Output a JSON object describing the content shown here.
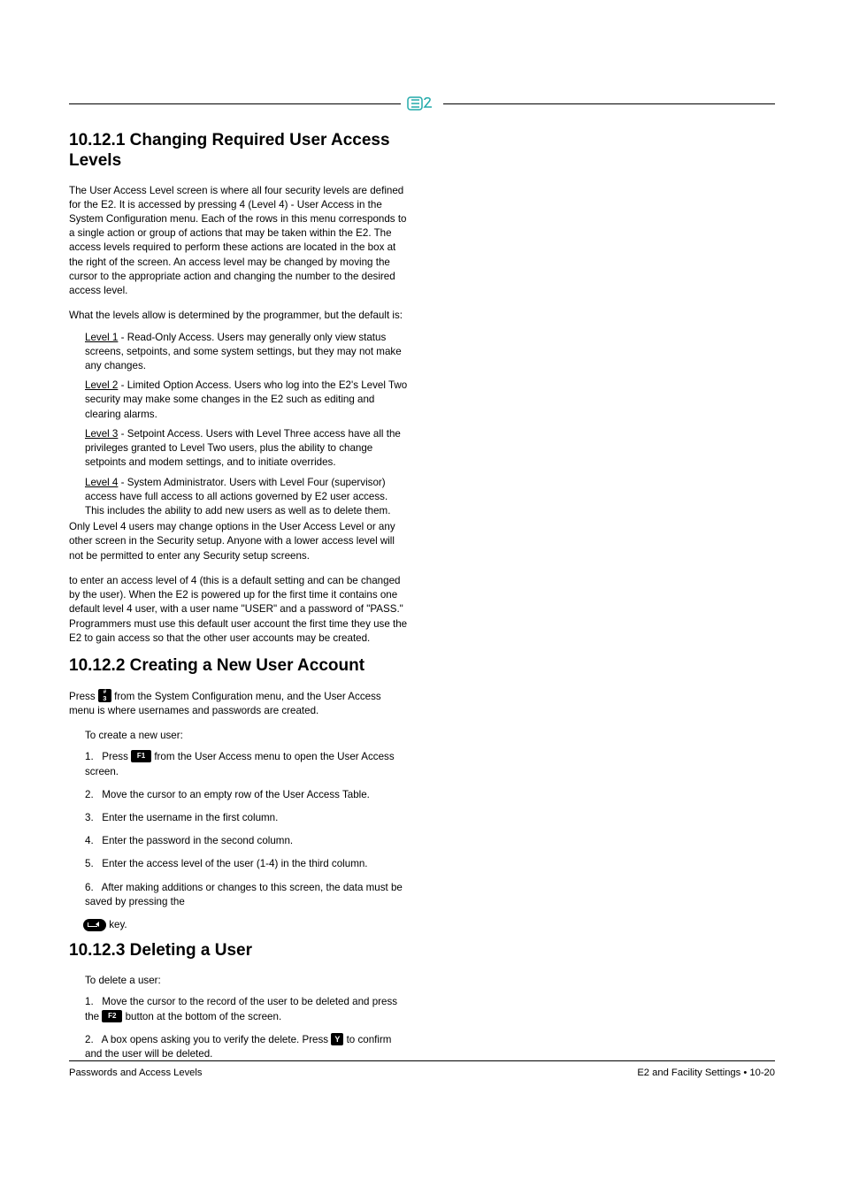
{
  "headings": {
    "s1": "10.12.1  Changing Required User Access Levels",
    "s2": "10.12.2  Creating a New User Account",
    "s3": "10.12.3  Deleting a User"
  },
  "col1": {
    "intro": "The User Access Level screen is where all four security levels are defined for the E2. It is accessed by pressing 4 (Level 4) - User Access in the System Configuration menu. Each of the rows in this menu corresponds to a single action or group of actions that may be taken within the E2. The access levels required to perform these actions are located in the box at the right of the screen. An access level may be changed by moving the cursor to the appropriate action and changing the number to the desired access level.",
    "intro2": "What the levels allow is determined by the programmer, but the default is:",
    "levels": [
      {
        "name": "Level 1",
        "title": "Read-Only Access.",
        "body": " Users may generally only view status screens, setpoints, and some system settings, but they may not make any changes."
      },
      {
        "name": "Level 2",
        "title": "Limited Option Access.",
        "body": " Users who log into the E2's Level Two security may make some changes in the E2 such as editing and clearing alarms."
      },
      {
        "name": "Level 3",
        "title": "Setpoint Access.",
        "body": " Users with Level Three access have all the privileges granted to Level Two users, plus the ability to change setpoints and modem settings, and to initiate overrides."
      },
      {
        "name": "Level 4",
        "title": "System Administrator.",
        "body": " Users with Level Four (supervisor) access have full access to all actions governed by E2 user access. This includes the ability to add new users as well as to delete them."
      }
    ]
  },
  "col2": {
    "p1a": "Only Level 4 users may change options in the User Access Level or any other screen in the Security setup. Anyone with a lower access level will not be permitted to enter any Security setup screens.",
    "p1b": "to enter an access level of 4 (this is a default setting and can be changed by the user). When the E2 is powered up for the first time it contains one default level 4 user, with a user name \"USER\" and a password of \"PASS.\" Programmers must use this default user account the first time they use the E2 to gain access so that the other user accounts may be created.",
    "s2_p1_a": "Press ",
    "s2_p1_b": " from the System Configuration menu, and the User Access menu is where usernames and passwords are created.",
    "s2_p2": "To create a new user:",
    "steps_s2": [
      {
        "n": "1.",
        "a": "Press ",
        "b": " from the User Access menu to open the User Access screen."
      },
      {
        "n": "2.",
        "a": "Move the cursor to an empty row of the User Access Table."
      },
      {
        "n": "3.",
        "a": "Enter the username in the first column."
      },
      {
        "n": "4.",
        "a": "Enter the password in the second column."
      },
      {
        "n": "5.",
        "a": "Enter the access level of the user (1-4) in the third column."
      },
      {
        "n": "6.",
        "a": "After making additions or changes to this screen, the data must be saved by pressing the "
      }
    ],
    "s3_pre": "To delete a user:",
    "steps_s3": [
      {
        "n": "1.",
        "a": "Move the cursor to the record of the user to be deleted and press the ",
        "b": " button at the bottom of the screen."
      },
      {
        "n": "2.",
        "a": "A box opens asking you to verify the delete. Press ",
        "b": " to confirm and the user will be deleted."
      }
    ]
  },
  "keys": {
    "three_top": "#",
    "three_bot": "3",
    "f1": "F1",
    "f2": "F2",
    "y": "Y"
  },
  "footer": {
    "left": "Passwords and Access Levels",
    "center": "E2 and Facility Settings • 10-20"
  }
}
